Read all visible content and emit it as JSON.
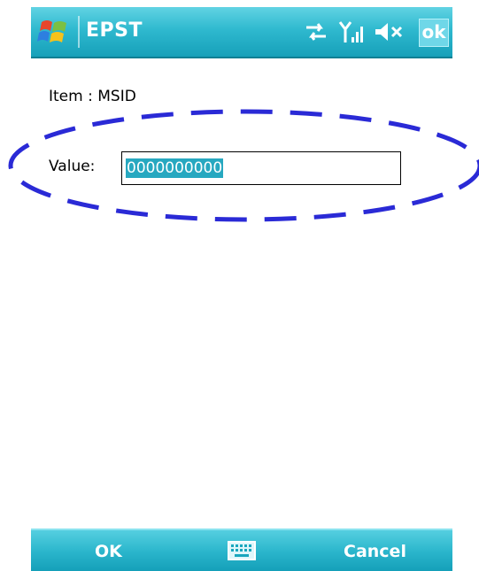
{
  "titlebar": {
    "app_title": "EPST",
    "ok_label": "ok",
    "icons": [
      "windows-start-icon",
      "connectivity-icon",
      "signal-strength-icon",
      "volume-muted-icon"
    ]
  },
  "content": {
    "item_label": "Item : MSID",
    "value_label": "Value:",
    "value_text": "0000000000"
  },
  "softkeys": {
    "left_label": "OK",
    "right_label": "Cancel",
    "center_icon": "keyboard-icon"
  },
  "colors": {
    "bar_accent": "#2fb9cf",
    "selection": "#27a8c0",
    "annotation_oval": "#2a2ad6"
  }
}
